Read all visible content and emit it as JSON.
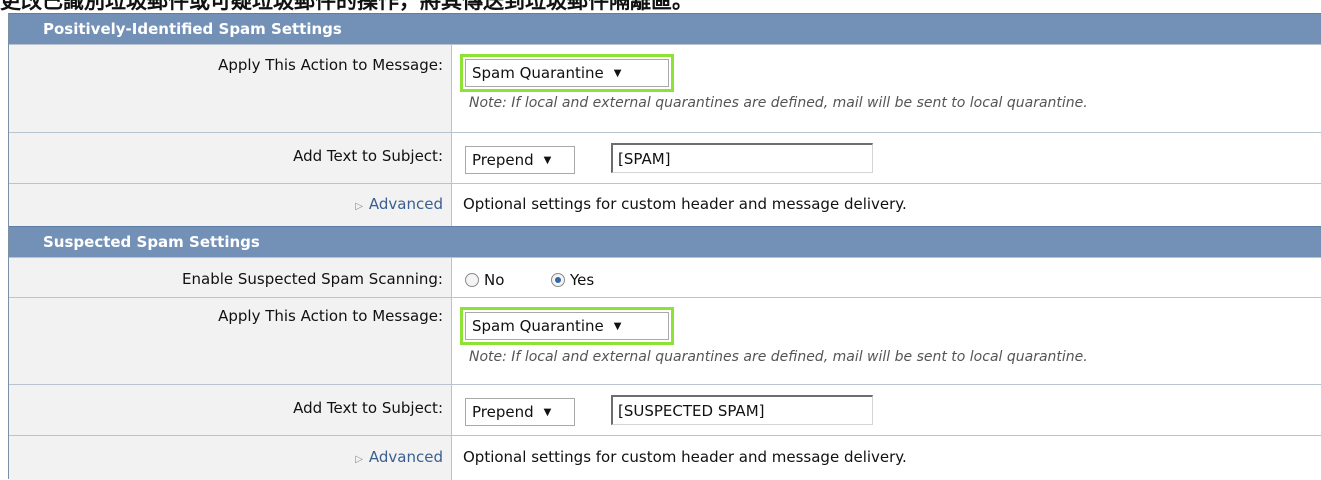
{
  "caption": "更改已識別垃圾郵件或可疑垃圾郵件的操作，將其傳送到垃圾郵件隔離區。",
  "positive": {
    "header": "Positively-Identified Spam Settings",
    "action_label": "Apply This Action to Message:",
    "action_value": "Spam Quarantine",
    "note": "Note: If local and external quarantines are defined, mail will be sent to local quarantine.",
    "subject_label": "Add Text to Subject:",
    "subject_mode": "Prepend",
    "subject_text": "[SPAM]",
    "advanced_label": "Advanced",
    "advanced_desc": "Optional settings for custom header and message delivery."
  },
  "suspected": {
    "header": "Suspected Spam Settings",
    "enable_label": "Enable Suspected Spam Scanning:",
    "enable_options": [
      "No",
      "Yes"
    ],
    "enable_selected": "Yes",
    "action_label": "Apply This Action to Message:",
    "action_value": "Spam Quarantine",
    "note": "Note: If local and external quarantines are defined, mail will be sent to local quarantine.",
    "subject_label": "Add Text to Subject:",
    "subject_mode": "Prepend",
    "subject_text": "[SUSPECTED SPAM]",
    "advanced_label": "Advanced",
    "advanced_desc": "Optional settings for custom header and message delivery."
  },
  "colors": {
    "header_bg": "#7391b7",
    "highlight": "#8ce335",
    "label_bg": "#f2f2f2",
    "link": "#3a5f8e"
  },
  "icons": [
    "chevron-down-icon",
    "triangle-right-icon",
    "radio-icon"
  ]
}
